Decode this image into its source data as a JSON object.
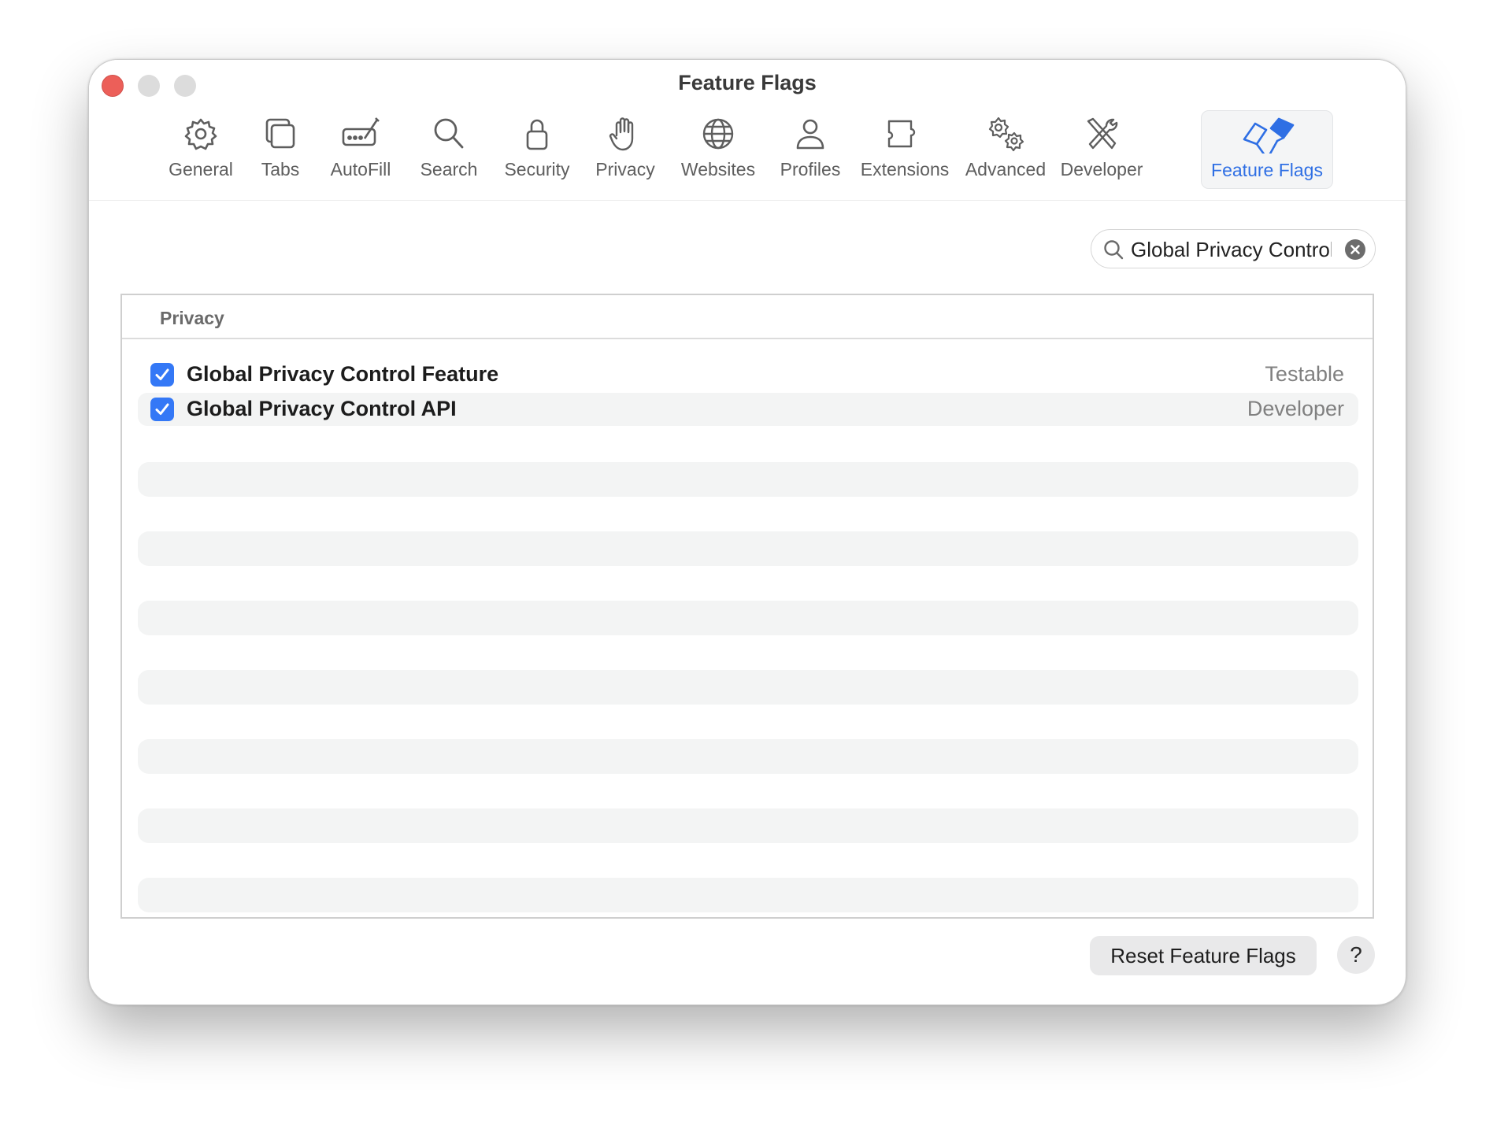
{
  "window": {
    "title": "Feature Flags"
  },
  "toolbar": {
    "items": [
      {
        "label": "General",
        "icon": "gear-icon"
      },
      {
        "label": "Tabs",
        "icon": "tabs-icon"
      },
      {
        "label": "AutoFill",
        "icon": "autofill-icon"
      },
      {
        "label": "Search",
        "icon": "search-icon"
      },
      {
        "label": "Security",
        "icon": "lock-icon"
      },
      {
        "label": "Privacy",
        "icon": "hand-icon"
      },
      {
        "label": "Websites",
        "icon": "globe-icon"
      },
      {
        "label": "Profiles",
        "icon": "person-icon"
      },
      {
        "label": "Extensions",
        "icon": "puzzle-icon"
      },
      {
        "label": "Advanced",
        "icon": "gears-icon"
      },
      {
        "label": "Developer",
        "icon": "tools-icon"
      },
      {
        "label": "Feature Flags",
        "icon": "flags-icon",
        "selected": true
      }
    ]
  },
  "search": {
    "value": "Global Privacy Control"
  },
  "section": {
    "header": "Privacy",
    "flags": [
      {
        "name": "Global Privacy Control Feature",
        "status": "Testable",
        "checked": true
      },
      {
        "name": "Global Privacy Control API",
        "status": "Developer",
        "checked": true
      }
    ]
  },
  "footer": {
    "reset_label": "Reset Feature Flags",
    "help_label": "?"
  },
  "colors": {
    "accent": "#3478f6",
    "selected_tab_text": "#2f6fe4",
    "close_button": "#ec5f59"
  }
}
